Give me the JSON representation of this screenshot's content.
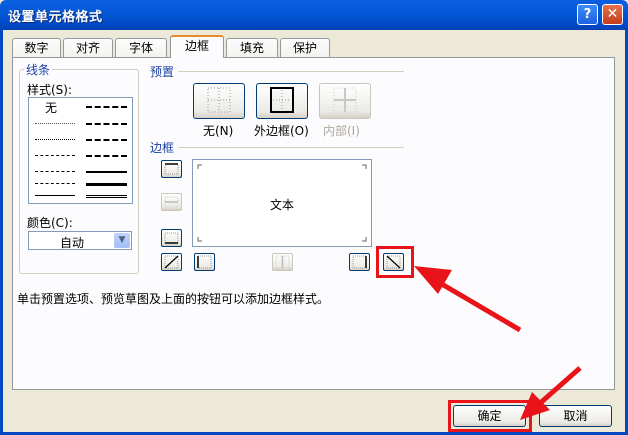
{
  "window": {
    "title": "设置单元格格式",
    "help_label": "?",
    "close_label": "✕"
  },
  "tabs": [
    "数字",
    "对齐",
    "字体",
    "边框",
    "填充",
    "保护"
  ],
  "line_group": {
    "title": "线条",
    "style_label": "样式(S):",
    "none_label": "无",
    "color_label": "颜色(C):",
    "color_value": "自动"
  },
  "presets": {
    "title": "预置",
    "items": [
      {
        "label": "无(N)"
      },
      {
        "label": "外边框(O)"
      },
      {
        "label": "内部(I)"
      }
    ]
  },
  "border": {
    "title": "边框",
    "preview_text": "文本"
  },
  "hint": "单击预置选项、预览草图及上面的按钮可以添加边框样式。",
  "buttons": {
    "ok": "确定",
    "cancel": "取消"
  },
  "colors": {
    "title_bar": "#0458d8",
    "highlight": "#e8141a",
    "accent_tab": "#e68b2c"
  }
}
